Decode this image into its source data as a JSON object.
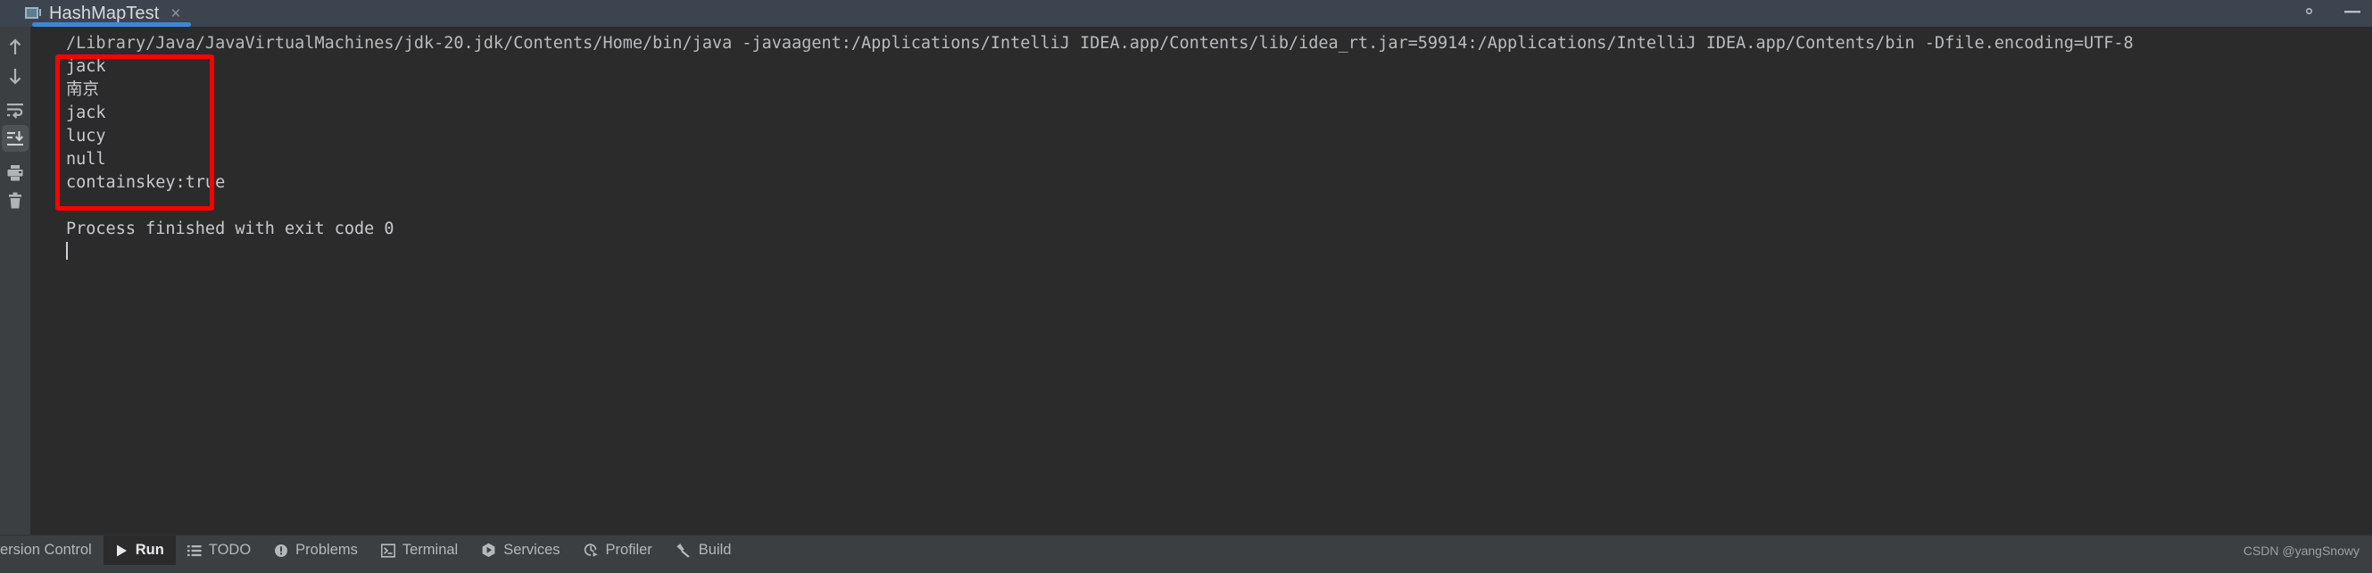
{
  "tab": {
    "title": "HashMapTest",
    "icon": "run-configuration-icon",
    "close_label": "×"
  },
  "tabbar_right": {
    "settings_label": "gear-icon",
    "minimize_label": "minimize-icon"
  },
  "gutter": {
    "items": [
      {
        "name": "up-arrow-icon",
        "label": "Up"
      },
      {
        "name": "down-arrow-icon",
        "label": "Down"
      },
      {
        "name": "soft-wrap-icon",
        "label": "Soft-Wrap"
      },
      {
        "name": "scroll-to-end-icon",
        "label": "Scroll to End"
      },
      {
        "name": "print-icon",
        "label": "Print"
      },
      {
        "name": "trash-icon",
        "label": "Clear All"
      }
    ]
  },
  "console": {
    "command_line": "/Library/Java/JavaVirtualMachines/jdk-20.jdk/Contents/Home/bin/java -javaagent:/Applications/IntelliJ IDEA.app/Contents/lib/idea_rt.jar=59914:/Applications/IntelliJ IDEA.app/Contents/bin -Dfile.encoding=UTF-8",
    "output_lines": [
      "jack",
      "南京",
      "jack",
      "lucy",
      "null",
      "containskey:true"
    ],
    "process_finished": "Process finished with exit code 0",
    "highlight_color": "#ff0000"
  },
  "statusbar": {
    "items": [
      {
        "label": "ersion Control",
        "icon": "version-control-icon",
        "active": false,
        "clipped": true
      },
      {
        "label": "Run",
        "icon": "play-icon",
        "active": true,
        "clipped": false
      },
      {
        "label": "TODO",
        "icon": "todo-list-icon",
        "active": false,
        "clipped": false
      },
      {
        "label": "Problems",
        "icon": "problems-icon",
        "active": false,
        "clipped": false
      },
      {
        "label": "Terminal",
        "icon": "terminal-icon",
        "active": false,
        "clipped": false
      },
      {
        "label": "Services",
        "icon": "services-icon",
        "active": false,
        "clipped": false
      },
      {
        "label": "Profiler",
        "icon": "profiler-icon",
        "active": false,
        "clipped": false
      },
      {
        "label": "Build",
        "icon": "build-hammer-icon",
        "active": false,
        "clipped": false
      }
    ],
    "watermark": "CSDN @yangSnowy"
  }
}
